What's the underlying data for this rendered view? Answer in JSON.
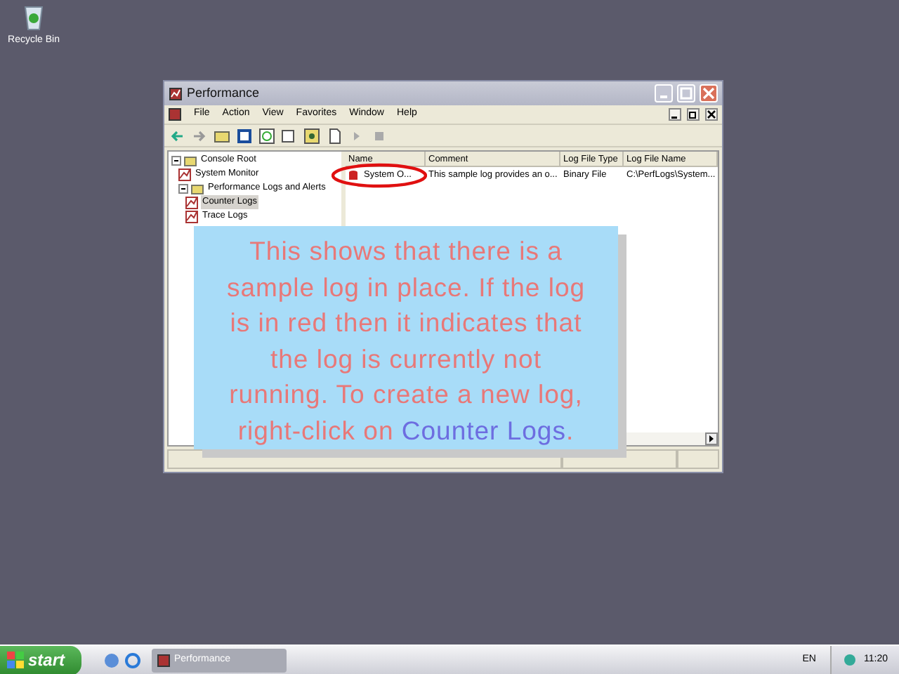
{
  "desktop_icons": [
    {
      "label": "Recycle Bin"
    }
  ],
  "window": {
    "title": "Performance",
    "menu": [
      "File",
      "Action",
      "View",
      "Favorites",
      "Window",
      "Help"
    ],
    "tree": [
      {
        "label": "Console Root",
        "expanded": true,
        "selected": false,
        "children": [
          {
            "label": "System Monitor",
            "selected": false
          },
          {
            "label": "Performance Logs and Alerts",
            "expanded": true,
            "selected": false,
            "children": [
              {
                "label": "Counter Logs",
                "selected": true
              },
              {
                "label": "Trace Logs",
                "selected": false
              }
            ]
          }
        ]
      }
    ],
    "table": {
      "columns": [
        "Name",
        "Comment",
        "Log File Type",
        "Log File Name"
      ],
      "rows": [
        {
          "cells": [
            "System O...",
            "This sample log provides an o...",
            "Binary File",
            "C:\\PerfLogs\\System..."
          ],
          "running": false
        }
      ]
    }
  },
  "callout": {
    "segments": [
      {
        "text": "This shows that there is a sample log in place. If the log is in red then it indicates that the log is currently not running. To create a new log, right-click on ",
        "kind": "plain"
      },
      {
        "text": "Counter Logs",
        "kind": "highlight"
      },
      {
        "text": ".",
        "kind": "plain"
      }
    ]
  },
  "taskbar": {
    "start": "start",
    "tasks": [
      {
        "label": "Performance",
        "selected": true
      }
    ],
    "language": "EN",
    "clock": "11:20"
  }
}
